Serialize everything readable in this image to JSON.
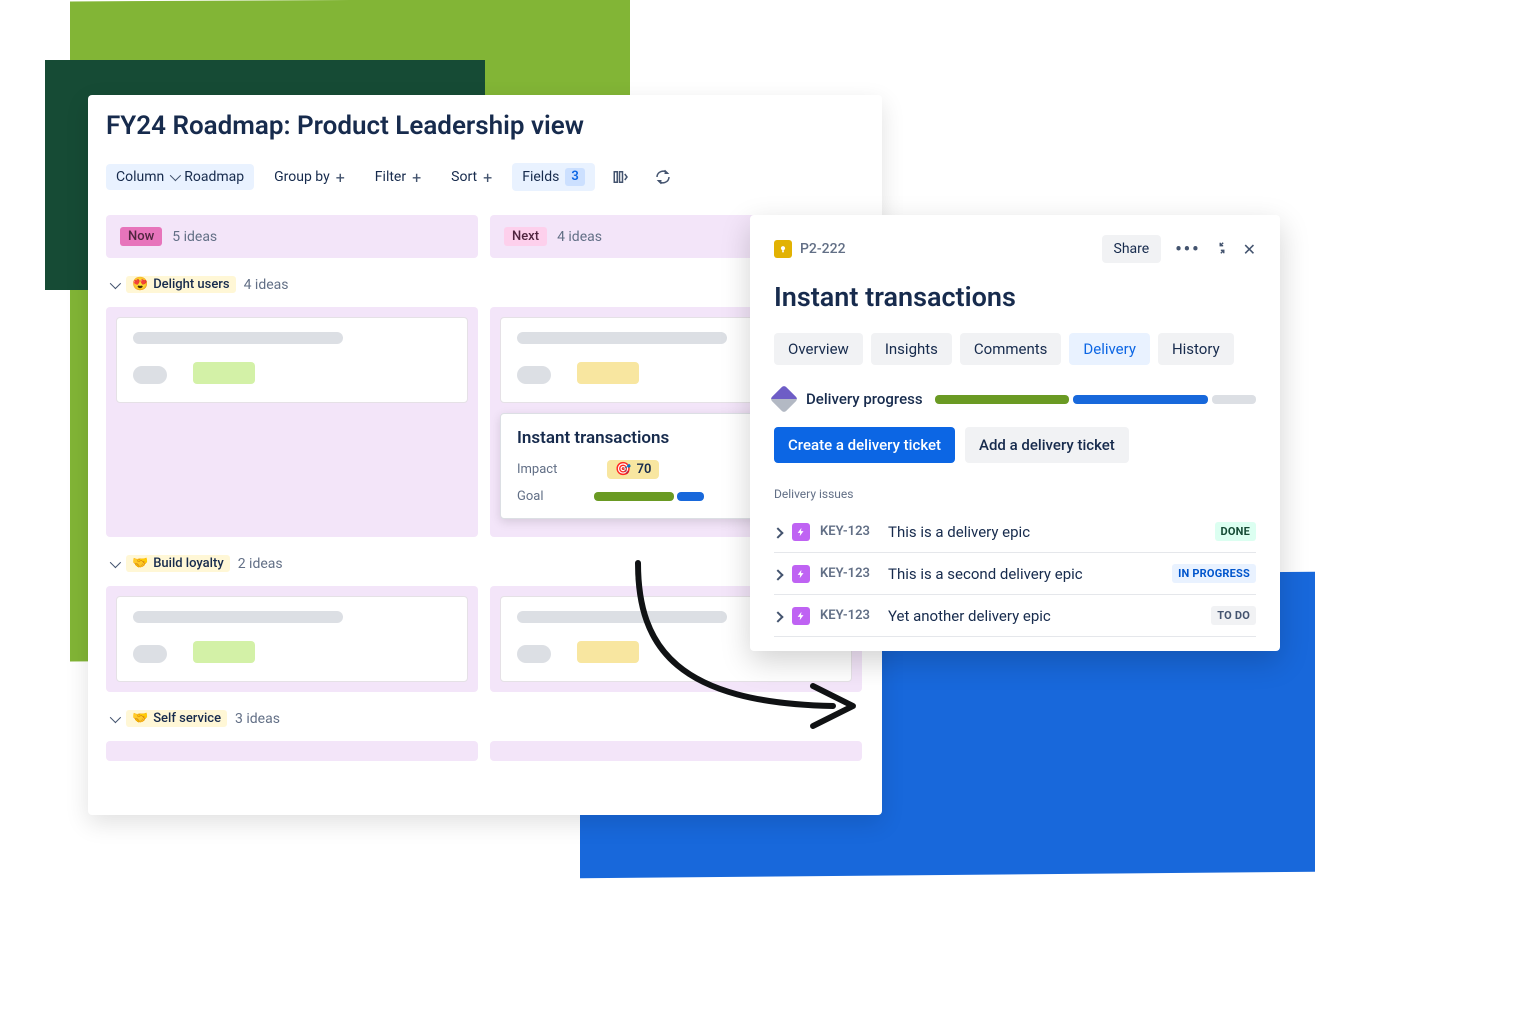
{
  "board": {
    "title": "FY24 Roadmap: Product Leadership view",
    "toolbar": {
      "column_label": "Column",
      "column_value": "Roadmap",
      "group_by": "Group by",
      "filter": "Filter",
      "sort": "Sort",
      "fields": "Fields",
      "fields_count": "3"
    },
    "columns": [
      {
        "tag": "Now",
        "ideas": "5 ideas"
      },
      {
        "tag": "Next",
        "ideas": "4 ideas"
      }
    ],
    "groups": [
      {
        "emoji": "😍",
        "name": "Delight users",
        "ideas": "4 ideas"
      },
      {
        "emoji": "🤝",
        "name": "Build loyalty",
        "ideas": "2 ideas"
      },
      {
        "emoji": "🤝",
        "name": "Self service",
        "ideas": "3 ideas"
      }
    ],
    "feature_card": {
      "title": "Instant transactions",
      "impact_label": "Impact",
      "impact_value": "70",
      "goal_label": "Goal"
    }
  },
  "panel": {
    "issue_key": "P2-222",
    "share": "Share",
    "title": "Instant transactions",
    "tabs": [
      "Overview",
      "Insights",
      "Comments",
      "Delivery",
      "History"
    ],
    "active_tab": 3,
    "delivery_progress_label": "Delivery progress",
    "create_btn": "Create a delivery ticket",
    "add_btn": "Add a delivery ticket",
    "issues_label": "Delivery issues",
    "issues": [
      {
        "key": "KEY-123",
        "title": "This is a delivery epic",
        "status": "DONE",
        "status_class": "lz-done"
      },
      {
        "key": "KEY-123",
        "title": "This is a second delivery epic",
        "status": "IN PROGRESS",
        "status_class": "lz-progress"
      },
      {
        "key": "KEY-123",
        "title": "Yet another delivery epic",
        "status": "TO DO",
        "status_class": "lz-todo"
      }
    ]
  }
}
